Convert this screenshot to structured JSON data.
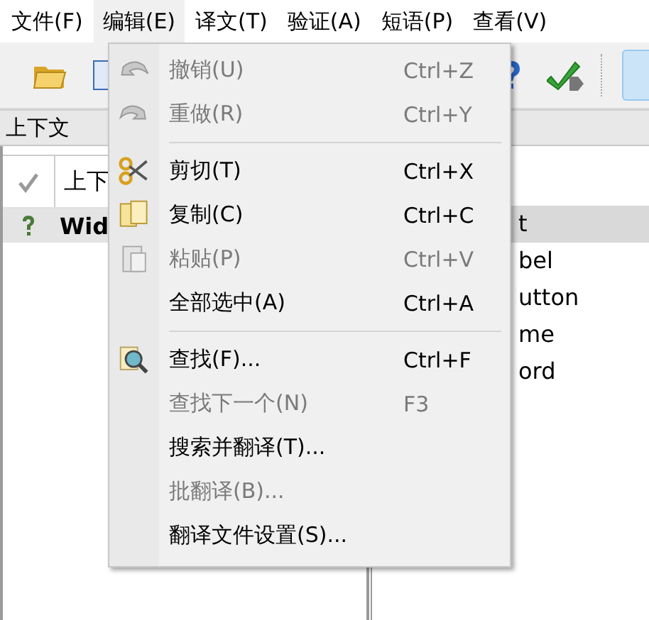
{
  "menubar": [
    {
      "label": "文件(F)",
      "selected": false
    },
    {
      "label": "编辑(E)",
      "selected": true
    },
    {
      "label": "译文(T)",
      "selected": false
    },
    {
      "label": "验证(A)",
      "selected": false
    },
    {
      "label": "短语(P)",
      "selected": false
    },
    {
      "label": "查看(V)",
      "selected": false
    }
  ],
  "context_dock": {
    "title": "上下文",
    "header": {
      "column_2": "上下"
    },
    "rows": [
      {
        "label": "Wid",
        "selected": true
      }
    ]
  },
  "right_panel": {
    "rows": [
      {
        "label": "t",
        "selected": true
      },
      {
        "label": "bel",
        "selected": false
      },
      {
        "label": "utton",
        "selected": false
      },
      {
        "label": "me",
        "selected": false
      },
      {
        "label": "ord",
        "selected": false
      }
    ]
  },
  "edit_menu": {
    "items": [
      {
        "kind": "action",
        "label": "撤销(U)",
        "shortcut": "Ctrl+Z",
        "disabled": true
      },
      {
        "kind": "action",
        "label": "重做(R)",
        "shortcut": "Ctrl+Y",
        "disabled": true
      },
      {
        "kind": "separator"
      },
      {
        "kind": "action",
        "label": "剪切(T)",
        "shortcut": "Ctrl+X",
        "disabled": false
      },
      {
        "kind": "action",
        "label": "复制(C)",
        "shortcut": "Ctrl+C",
        "disabled": false
      },
      {
        "kind": "action",
        "label": "粘贴(P)",
        "shortcut": "Ctrl+V",
        "disabled": true
      },
      {
        "kind": "action",
        "label": "全部选中(A)",
        "shortcut": "Ctrl+A",
        "disabled": false
      },
      {
        "kind": "separator"
      },
      {
        "kind": "action",
        "label": "查找(F)...",
        "shortcut": "Ctrl+F",
        "disabled": false
      },
      {
        "kind": "action",
        "label": "查找下一个(N)",
        "shortcut": "F3",
        "disabled": true
      },
      {
        "kind": "action",
        "label": "搜索并翻译(T)...",
        "disabled": false
      },
      {
        "kind": "action",
        "label": "批翻译(B)...",
        "disabled": true
      },
      {
        "kind": "action",
        "label": "翻译文件设置(S)...",
        "disabled": false
      }
    ]
  }
}
